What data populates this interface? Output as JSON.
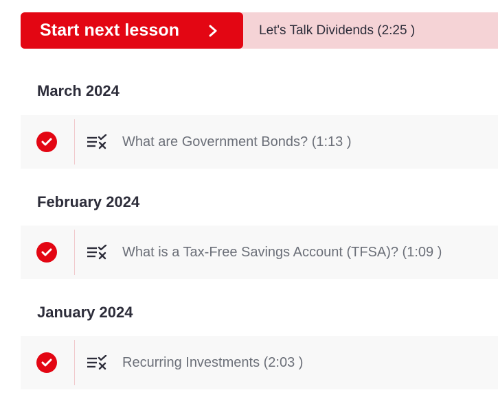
{
  "banner": {
    "start_label": "Start next lesson",
    "next_lesson_title": "Let's Talk Dividends (2:25 )"
  },
  "colors": {
    "accent": "#e30613",
    "banner_tint": "#f5d3d6",
    "row_background": "#f8f8f8",
    "heading_text": "#2d2d3a",
    "lesson_text": "#6b6f78"
  },
  "sections": [
    {
      "month": "March 2024",
      "lessons": [
        {
          "title": "What are Government Bonds? (1:13 )",
          "status_icon": "check-circle-icon",
          "type_icon": "quiz-list-icon"
        }
      ]
    },
    {
      "month": "February 2024",
      "lessons": [
        {
          "title": "What is a Tax-Free Savings Account (TFSA)? (1:09 )",
          "status_icon": "check-circle-icon",
          "type_icon": "quiz-list-icon"
        }
      ]
    },
    {
      "month": "January 2024",
      "lessons": [
        {
          "title": "Recurring Investments (2:03 )",
          "status_icon": "check-circle-icon",
          "type_icon": "quiz-list-icon"
        }
      ]
    }
  ]
}
